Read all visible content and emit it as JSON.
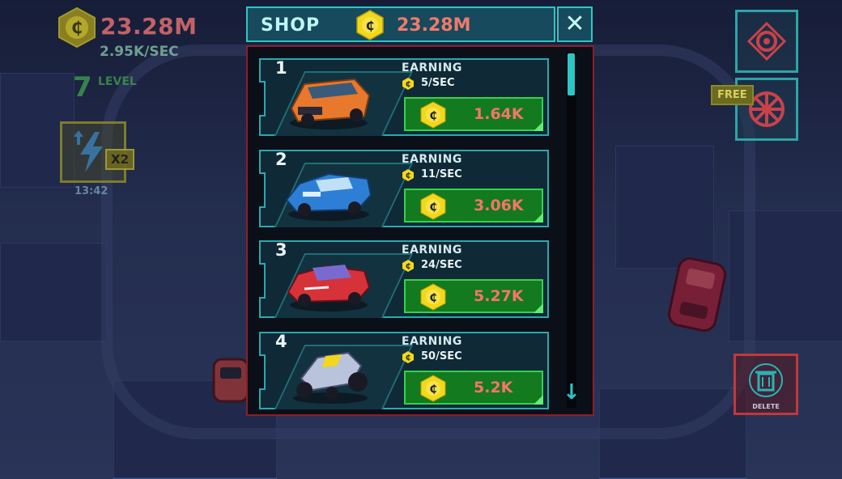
{
  "hud": {
    "money": "23.28M",
    "rate": "2.95K/SEC",
    "level_number": "7",
    "level_label": "LEVEL",
    "boost_multiplier": "X2",
    "boost_timer": "13:42",
    "free_label": "FREE",
    "delete_label": "DELETE"
  },
  "shop": {
    "title": "SHOP",
    "money": "23.28M",
    "close_label": "✕",
    "scroll_down_label": "↓",
    "items": [
      {
        "number": "1",
        "earning_label": "EARNING",
        "rate": "5/SEC",
        "price": "1.64K",
        "car_color": "#e8782b",
        "car_icon": "orange-van-icon"
      },
      {
        "number": "2",
        "earning_label": "EARNING",
        "rate": "11/SEC",
        "price": "3.06K",
        "car_color": "#2d7fd6",
        "car_icon": "blue-muscle-car-icon"
      },
      {
        "number": "3",
        "earning_label": "EARNING",
        "rate": "24/SEC",
        "price": "5.27K",
        "car_color": "#d6323a",
        "car_icon": "red-mini-car-icon"
      },
      {
        "number": "4",
        "earning_label": "EARNING",
        "rate": "50/SEC",
        "price": "5.2K",
        "car_color": "#b9c3dc",
        "car_icon": "hot-rod-icon"
      }
    ]
  },
  "colors": {
    "accent_teal": "#2cc7c7",
    "money_red": "#f07a6c",
    "buy_green": "#137a1f",
    "coin_yellow": "#f2d81a"
  }
}
